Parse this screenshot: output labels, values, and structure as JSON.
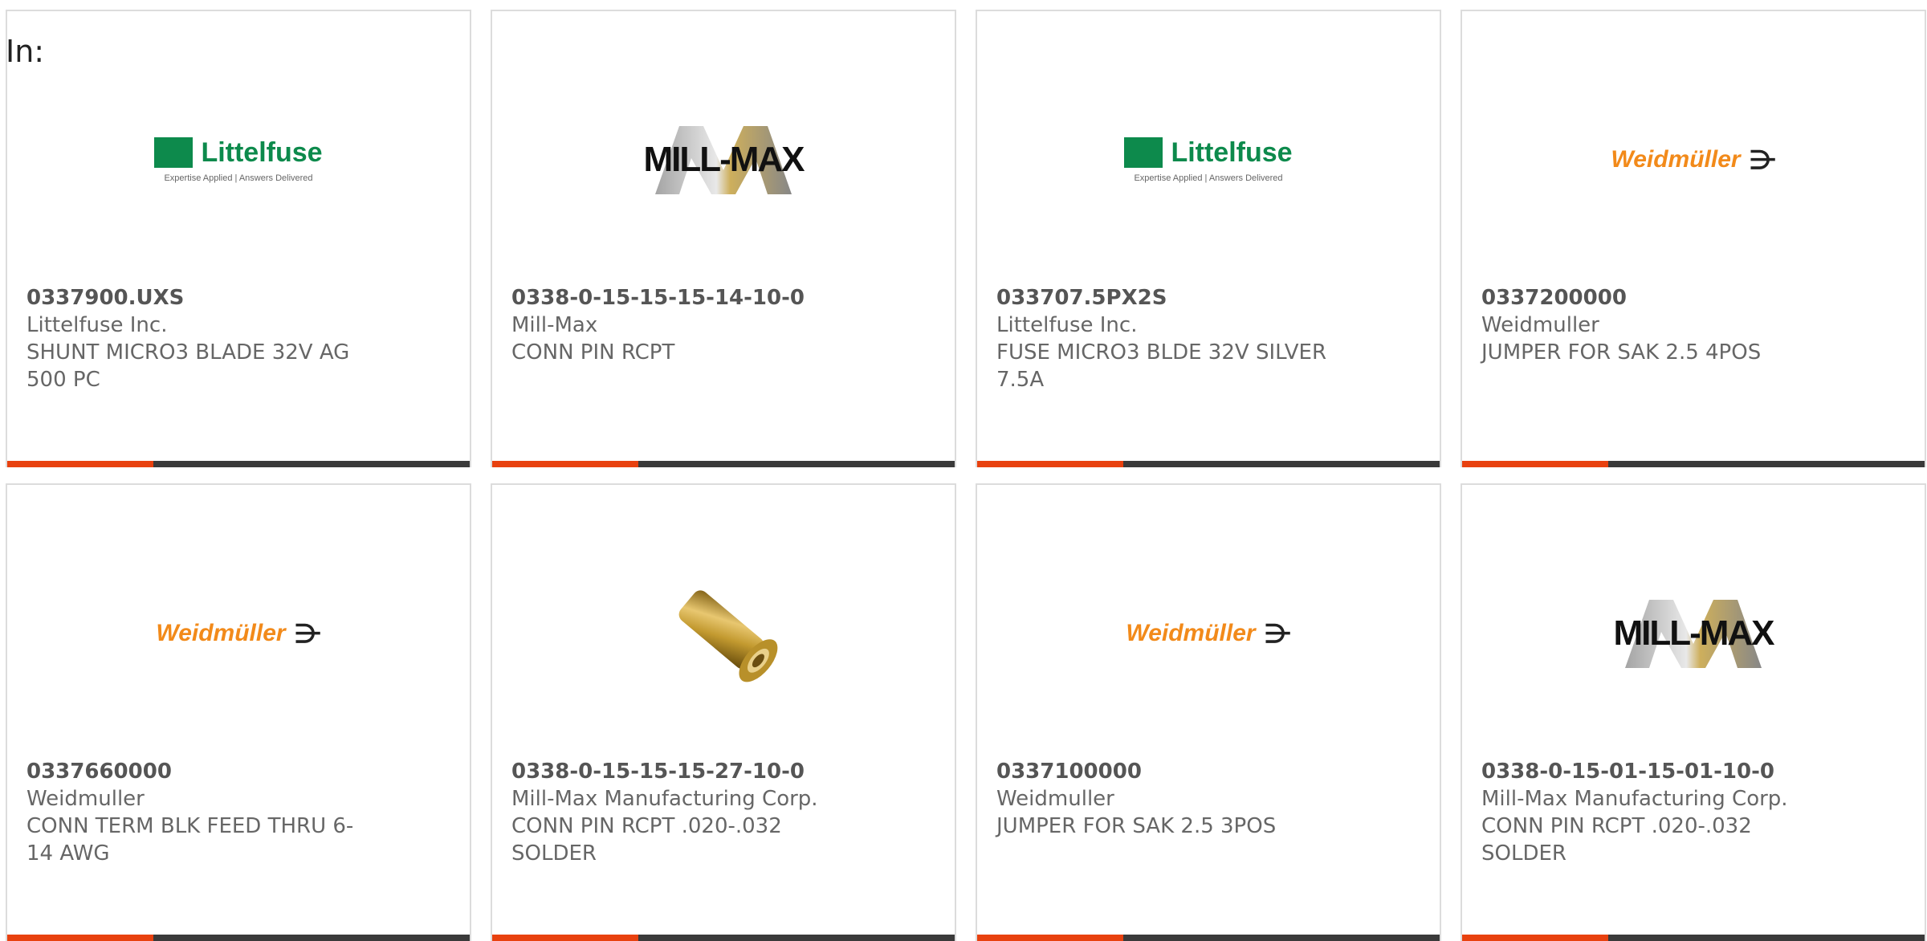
{
  "filter": {
    "label": "In:"
  },
  "colors": {
    "accent": "#e8410f",
    "bar": "#3a3a3a",
    "littelfuse_green": "#0d8a4c",
    "weidmuller_orange": "#f28a1a"
  },
  "products": [
    {
      "part_number": "0337900.UXS",
      "manufacturer": "Littelfuse Inc.",
      "description": "SHUNT MICRO3 BLADE 32V AG 500 PC",
      "image": "littelfuse-logo",
      "logo_name": "Littelfuse",
      "logo_tagline": "Expertise Applied | Answers Delivered"
    },
    {
      "part_number": "0338-0-15-15-15-14-10-0",
      "manufacturer": "Mill-Max",
      "description": "CONN PIN RCPT",
      "image": "millmax-logo",
      "logo_name": "MILL-MAX"
    },
    {
      "part_number": "033707.5PX2S",
      "manufacturer": "Littelfuse Inc.",
      "description": "FUSE MICRO3 BLDE 32V SILVER 7.5A",
      "image": "littelfuse-logo",
      "logo_name": "Littelfuse",
      "logo_tagline": "Expertise Applied | Answers Delivered"
    },
    {
      "part_number": "0337200000",
      "manufacturer": "Weidmuller",
      "description": "JUMPER FOR SAK 2.5 4POS",
      "image": "weidmuller-logo",
      "logo_name": "Weidmüller"
    },
    {
      "part_number": "0337660000",
      "manufacturer": "Weidmuller",
      "description": "CONN TERM BLK FEED THRU 6-14 AWG",
      "image": "weidmuller-logo",
      "logo_name": "Weidmüller"
    },
    {
      "part_number": "0338-0-15-15-15-27-10-0",
      "manufacturer": "Mill-Max Manufacturing Corp.",
      "description": "CONN PIN RCPT .020-.032 SOLDER",
      "image": "pin-photo"
    },
    {
      "part_number": "0337100000",
      "manufacturer": "Weidmuller",
      "description": "JUMPER FOR SAK 2.5 3POS",
      "image": "weidmuller-logo",
      "logo_name": "Weidmüller"
    },
    {
      "part_number": "0338-0-15-01-15-01-10-0",
      "manufacturer": "Mill-Max Manufacturing Corp.",
      "description": "CONN PIN RCPT .020-.032 SOLDER",
      "image": "millmax-logo",
      "logo_name": "MILL-MAX"
    }
  ]
}
